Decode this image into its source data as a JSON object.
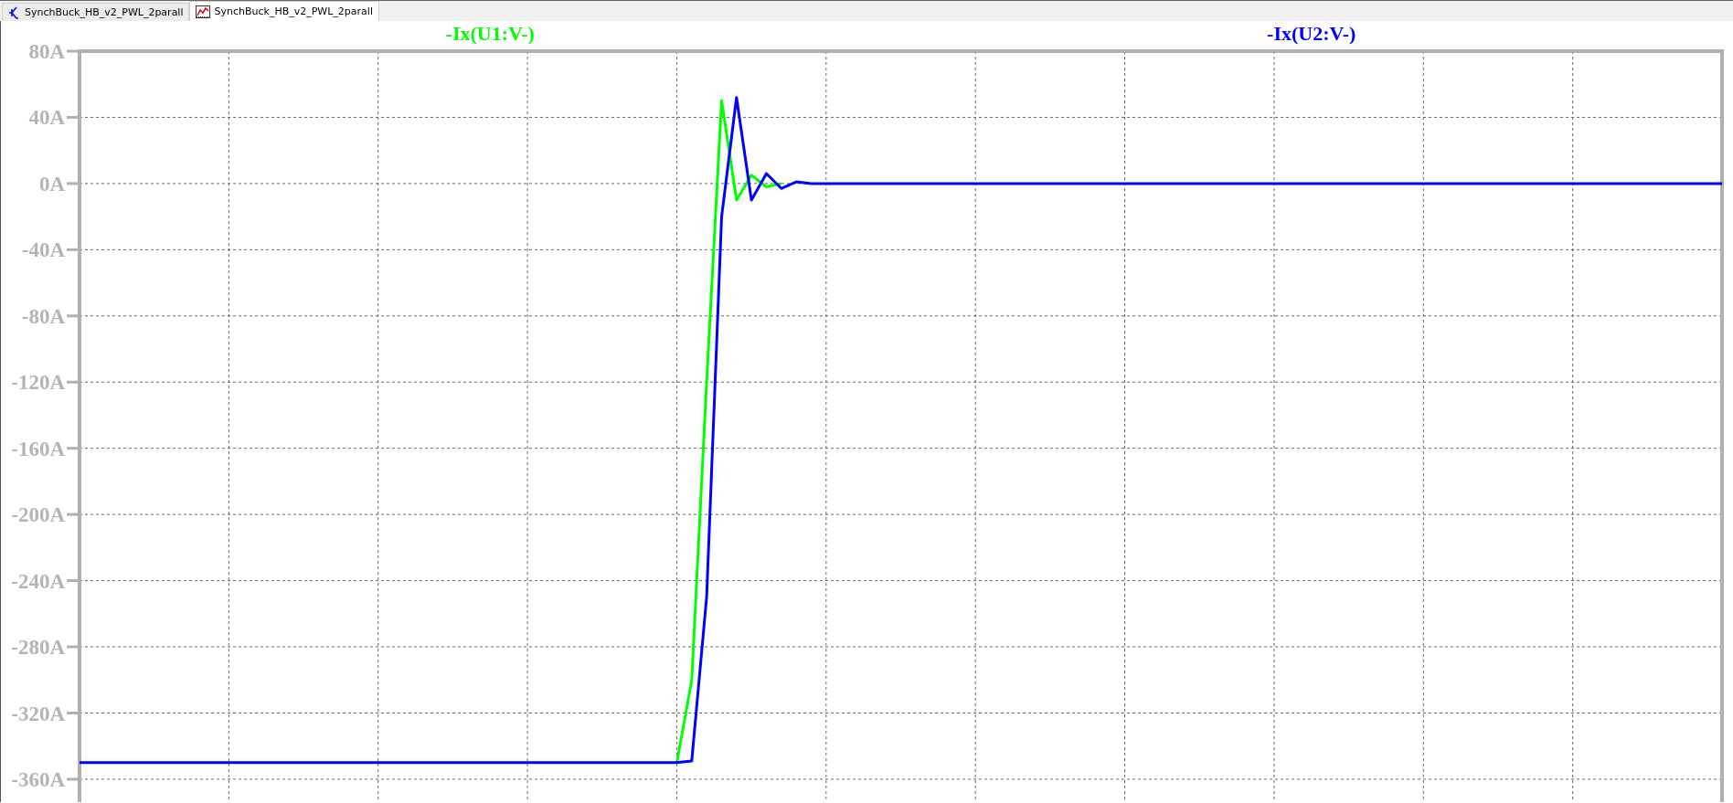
{
  "tabs": [
    {
      "label": "SynchBuck_HB_v2_PWL_2parall",
      "kind": "schematic",
      "selected": false
    },
    {
      "label": "SynchBuck_HB_v2_PWL_2parall",
      "kind": "waveform",
      "selected": true
    }
  ],
  "plot": {
    "chart_data": {
      "type": "line",
      "grid": true,
      "ylim": [
        -360,
        80
      ],
      "yticks": [
        {
          "value": 80,
          "label": "80A"
        },
        {
          "value": 40,
          "label": "40A"
        },
        {
          "value": 0,
          "label": "0A"
        },
        {
          "value": -40,
          "label": "-40A"
        },
        {
          "value": -80,
          "label": "-80A"
        },
        {
          "value": -120,
          "label": "-120A"
        },
        {
          "value": -160,
          "label": "-160A"
        },
        {
          "value": -200,
          "label": "-200A"
        },
        {
          "value": -240,
          "label": "-240A"
        },
        {
          "value": -280,
          "label": "-280A"
        },
        {
          "value": -320,
          "label": "-320A"
        },
        {
          "value": -360,
          "label": "-360A"
        }
      ],
      "categories": [
        null,
        null,
        null,
        null,
        null,
        null,
        null,
        null,
        null,
        null,
        null,
        null,
        null,
        null,
        null,
        null,
        null,
        null,
        null,
        null,
        null,
        null,
        null,
        null,
        null,
        null,
        null,
        null,
        null,
        null,
        null,
        null,
        null,
        null,
        null,
        null,
        null,
        null,
        null,
        null,
        null,
        null,
        null,
        null,
        null,
        null,
        null,
        null,
        null,
        null,
        null,
        null,
        null,
        null,
        null,
        null,
        null,
        null,
        null,
        null,
        null,
        null,
        null,
        null,
        null,
        null,
        null,
        null,
        null,
        null,
        null,
        null,
        null,
        null,
        null,
        null,
        null,
        null,
        null,
        null,
        null,
        null,
        null,
        null,
        null,
        null,
        null,
        null,
        null,
        null,
        null,
        null,
        null,
        null,
        null,
        null,
        null,
        null,
        null,
        null,
        null,
        null,
        null,
        null,
        null,
        null,
        null,
        null,
        null,
        null,
        null
      ],
      "series": [
        {
          "name": "-Ix(U1:V-)",
          "color": "#00ff00",
          "values": [
            null,
            null,
            null,
            null,
            null,
            null,
            null,
            null,
            null,
            null,
            null,
            null,
            null,
            null,
            null,
            null,
            null,
            null,
            null,
            null,
            null,
            null,
            null,
            null,
            null,
            null,
            null,
            null,
            null,
            null,
            null,
            null,
            null,
            null,
            null,
            null,
            null,
            null,
            null,
            null,
            -350,
            -300,
            -120,
            50,
            -10,
            5,
            -2,
            0,
            null,
            null,
            null,
            null,
            null,
            null,
            null,
            null,
            null,
            null,
            null,
            null,
            null,
            null,
            null,
            null,
            null,
            null,
            null,
            null,
            null,
            null,
            null,
            null,
            null,
            null,
            null,
            null,
            null,
            null,
            null,
            null,
            null,
            null,
            null,
            null,
            null,
            null,
            null,
            null,
            null,
            null,
            null,
            null,
            null,
            null,
            null,
            null,
            null,
            null,
            null,
            null,
            null,
            null,
            null,
            null,
            null,
            null,
            null,
            null,
            null,
            null,
            null
          ]
        },
        {
          "name": "-Ix(U2:V-)",
          "color": "#0000ff",
          "values": [
            -350,
            -350,
            -350,
            -350,
            -350,
            -350,
            -350,
            -350,
            -350,
            -350,
            -350,
            -350,
            -350,
            -350,
            -350,
            -350,
            -350,
            -350,
            -350,
            -350,
            -350,
            -350,
            -350,
            -350,
            -350,
            -350,
            -350,
            -350,
            -350,
            -350,
            -350,
            -350,
            -350,
            -350,
            -350,
            -350,
            -350,
            -350,
            -350,
            -350,
            -350,
            -349,
            -250,
            -20,
            52,
            -10,
            6,
            -3,
            1,
            0,
            0,
            0,
            0,
            0,
            0,
            0,
            0,
            0,
            0,
            0,
            0,
            0,
            0,
            0,
            0,
            0,
            0,
            0,
            0,
            0,
            0,
            0,
            0,
            0,
            0,
            0,
            0,
            0,
            0,
            0,
            0,
            0,
            0,
            0,
            0,
            0,
            0,
            0,
            0,
            0,
            0,
            0,
            0,
            0,
            0,
            0,
            0,
            0,
            0,
            0,
            0,
            0,
            0,
            0,
            0,
            0,
            0,
            0,
            0,
            0,
            0
          ]
        }
      ]
    }
  }
}
